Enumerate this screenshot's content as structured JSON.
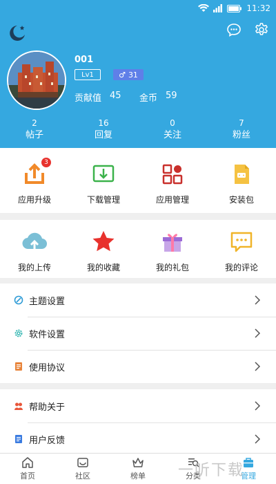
{
  "status_bar": {
    "time": "11:32",
    "icons": [
      "wifi-icon",
      "signal-icon",
      "battery-icon"
    ]
  },
  "header": {
    "background_color": "#35a8e0",
    "icons": [
      "moon-icon",
      "message-icon",
      "settings-icon"
    ],
    "username": "001",
    "level": "Lv1",
    "gender_symbol": "♂",
    "age": "31",
    "contribution_label": "贡献值",
    "contribution_value": "45",
    "coins_label": "金币",
    "coins_value": "59",
    "stats": [
      {
        "value": "2",
        "label": "帖子"
      },
      {
        "value": "16",
        "label": "回复"
      },
      {
        "value": "0",
        "label": "关注"
      },
      {
        "value": "7",
        "label": "粉丝"
      }
    ]
  },
  "app_tools": [
    {
      "label": "应用升级",
      "icon": "upgrade-icon",
      "badge": "3"
    },
    {
      "label": "下载管理",
      "icon": "download-icon"
    },
    {
      "label": "应用管理",
      "icon": "app-manage-icon"
    },
    {
      "label": "安装包",
      "icon": "apk-icon"
    }
  ],
  "my_items": [
    {
      "label": "我的上传",
      "icon": "upload-cloud-icon"
    },
    {
      "label": "我的收藏",
      "icon": "star-icon"
    },
    {
      "label": "我的礼包",
      "icon": "gift-icon"
    },
    {
      "label": "我的评论",
      "icon": "comment-icon"
    }
  ],
  "settings_list": [
    {
      "label": "主题设置",
      "icon": "theme-icon"
    },
    {
      "label": "软件设置",
      "icon": "gear-icon"
    },
    {
      "label": "使用协议",
      "icon": "document-icon"
    }
  ],
  "help_list": [
    {
      "label": "帮助关于",
      "icon": "help-icon"
    },
    {
      "label": "用户反馈",
      "icon": "feedback-icon"
    }
  ],
  "bottom_nav": [
    {
      "label": "首页",
      "icon": "home-icon"
    },
    {
      "label": "社区",
      "icon": "community-icon"
    },
    {
      "label": "榜单",
      "icon": "crown-icon"
    },
    {
      "label": "分类",
      "icon": "category-icon"
    },
    {
      "label": "管理",
      "icon": "manage-icon",
      "active": true
    }
  ],
  "watermark": "一听下载"
}
